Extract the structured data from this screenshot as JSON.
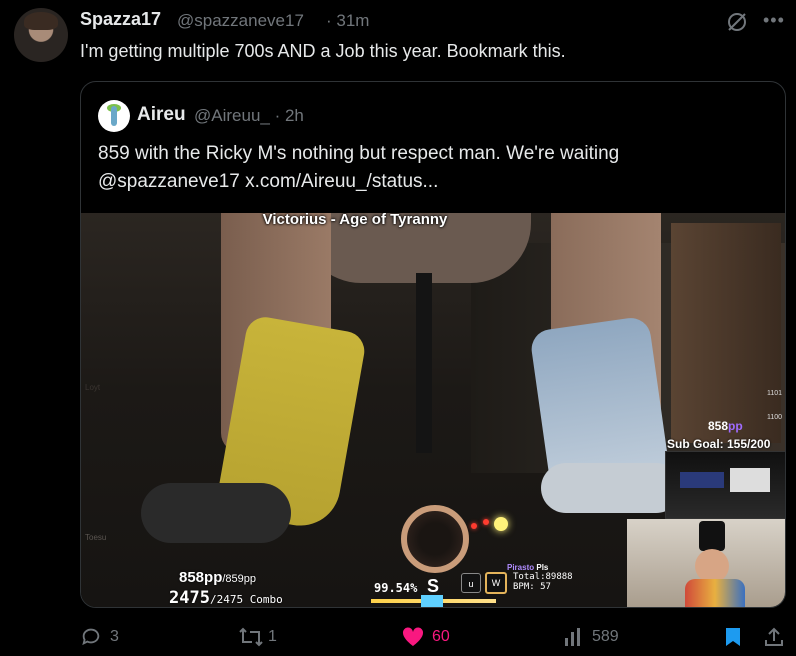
{
  "tweet": {
    "author_name": "Spazza17",
    "author_handle": "@spazzaneve17",
    "time": "· 31m",
    "text": "I'm getting multiple 700s AND a Job this year. Bookmark this."
  },
  "quote": {
    "author_name": "Aireu",
    "author_handle": "@Aireuu_",
    "time": "· 2h",
    "text_line1": "859 with the Ricky M's nothing but respect man. We're waiting",
    "text_line2": "@spazzaneve17  x.com/Aireuu_/status..."
  },
  "overlay": {
    "song_title": "Victorius - Age of Tyranny",
    "pp_current": "858pp",
    "pp_max": "/859pp",
    "combo_current": "2475",
    "combo_max": "/2475 Combo",
    "accuracy": "99.54%",
    "grade": "S",
    "key_u": "u",
    "key_w": "W",
    "player_name": "Pirasto",
    "player_tag": "Pls",
    "total_label": "Total:89888",
    "bpm_label": "BPM: 57",
    "stream_pp": "858",
    "stream_pp_unit": "pp",
    "sub_goal": "Sub Goal: 155/200",
    "tiny_1101": "1101",
    "tiny_1100": "1100",
    "faint_left_1": "Loyt",
    "faint_left_2": "Toesu"
  },
  "actions": {
    "reply_count": "3",
    "retweet_count": "1",
    "like_count": "60",
    "view_count": "589"
  },
  "colors": {
    "like": "#f91880",
    "bookmark": "#1d9bf0",
    "muted": "#71767b"
  }
}
